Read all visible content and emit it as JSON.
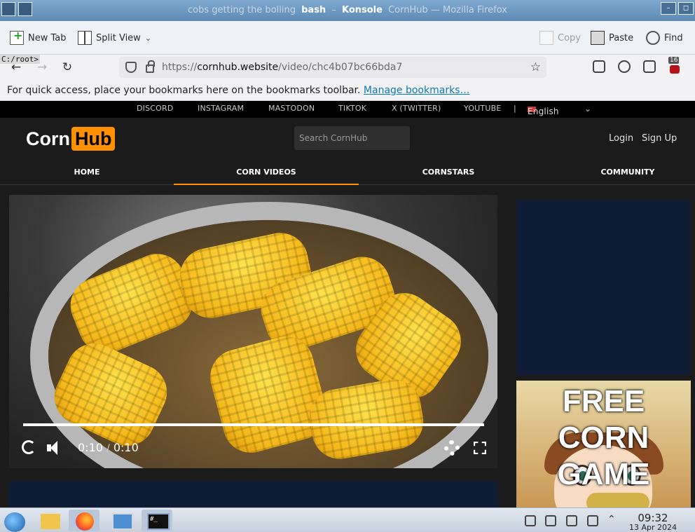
{
  "window": {
    "title_background": "cobs getting the bolling",
    "title_app_left": "bash",
    "title_app_right": "Konsole",
    "title_rest": "CornHub — Mozilla Firefox"
  },
  "konsole": {
    "new_tab_label": "New Tab",
    "split_view_label": "Split View",
    "copy_label": "Copy",
    "paste_label": "Paste",
    "find_label": "Find",
    "prompt_text": "C:/root>"
  },
  "firefox": {
    "url_scheme": "https://",
    "url_host": "cornhub.website",
    "url_path": "/video/chc4b07bc66bda7",
    "extension_badge": "16",
    "bookmarks_message": "For quick access, place your bookmarks here on the bookmarks toolbar.",
    "manage_bookmarks_link": "Manage bookmarks…"
  },
  "site": {
    "social_links": [
      "DISCORD",
      "INSTAGRAM",
      "MASTODON",
      "TIKTOK",
      "X (TWITTER)",
      "YOUTUBE"
    ],
    "divider": "|",
    "language": "English",
    "logo_word": "Corn",
    "logo_box": "Hub",
    "search_placeholder": "Search CornHub",
    "login_label": "Login",
    "signup_label": "Sign Up",
    "nav": [
      "HOME",
      "CORN VIDEOS",
      "CORNSTARS",
      "COMMUNITY"
    ],
    "active_nav": "CORN VIDEOS",
    "accent_color": "#ff9000"
  },
  "player": {
    "current_time": "0:10",
    "time_separator": "/",
    "duration": "0:10",
    "progress": 1.0
  },
  "promo": {
    "headline": "FREE CORN GAME"
  },
  "taskbar": {
    "clock_time": "09:32",
    "clock_date": "13 Apr 2024",
    "terminal_glyph": "#_"
  }
}
